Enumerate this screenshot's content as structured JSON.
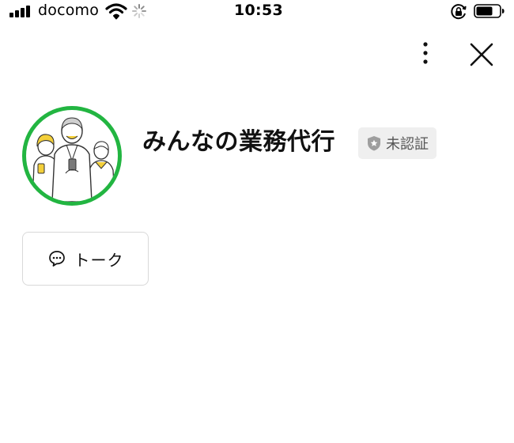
{
  "status_bar": {
    "carrier": "docomo",
    "time": "10:53",
    "icons": [
      "signal-bars-icon",
      "wifi-icon",
      "activity-spinner-icon",
      "rotation-lock-icon",
      "battery-icon"
    ]
  },
  "header": {
    "icons": [
      "more-vertical-icon",
      "close-icon"
    ]
  },
  "profile": {
    "name": "みんなの業務代行",
    "verification_badge": "未認証",
    "avatar_ring_color": "#22b541",
    "avatar_icon": "business-people-illustration"
  },
  "actions": {
    "talk_label": "トーク",
    "talk_icon": "chat-bubble-icon"
  }
}
